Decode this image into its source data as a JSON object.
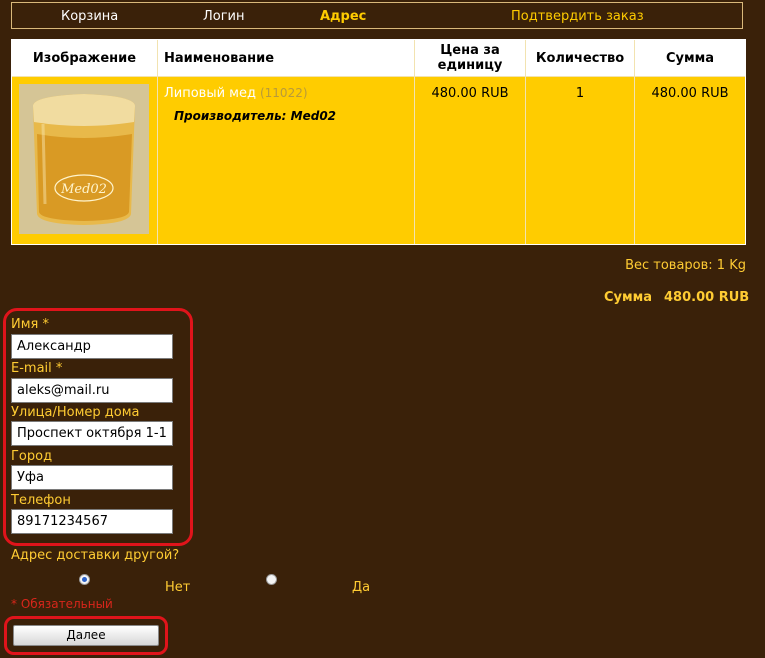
{
  "steps": {
    "cart": "Корзина",
    "login": "Логин",
    "address": "Адрес",
    "confirm": "Подтвердить заказ"
  },
  "cart_table": {
    "headers": {
      "image": "Изображение",
      "name": "Наименование",
      "price": "Цена за единицу",
      "qty": "Количество",
      "sum": "Сумма"
    },
    "item": {
      "name": "Липовый мед",
      "code": "(11022)",
      "manufacturer": "Производитель: Med02",
      "price": "480.00 RUB",
      "qty": "1",
      "sum": "480.00 RUB",
      "image_logo": "Med02"
    }
  },
  "summary": {
    "weight": "Вес товаров: 1 Kg",
    "total_label": "Сумма",
    "total_value": "480.00 RUB"
  },
  "form": {
    "name_label": "Имя *",
    "name_value": "Александр",
    "email_label": "E-mail *",
    "email_value": "aleks@mail.ru",
    "street_label": "Улица/Номер дома",
    "street_value": "Проспект октября 1-1",
    "city_label": "Город",
    "city_value": "Уфа",
    "phone_label": "Телефон",
    "phone_value": "89171234567",
    "other_address_question": "Адрес доставки другой?",
    "option_no": "Нет",
    "option_yes": "Да",
    "selected_option": "no",
    "required_note": "* Обязательный",
    "next_button": "Далее"
  },
  "colors": {
    "background": "#3a2109",
    "table_fill": "#ffcc00",
    "accent_text": "#ffcc33",
    "highlight_ring": "#e0141b"
  }
}
